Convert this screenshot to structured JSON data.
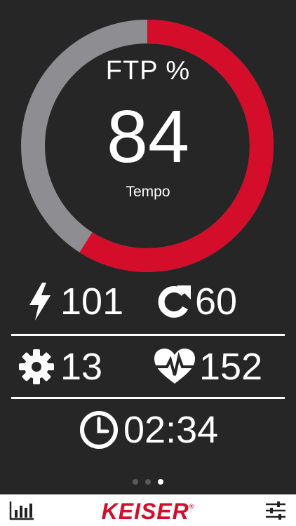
{
  "colors": {
    "background": "#262626",
    "ring_track": "#8e8e92",
    "ring_fill": "#d40d2b",
    "brand": "#d40d2b"
  },
  "gauge": {
    "label": "FTP %",
    "value": "84",
    "zone": "Tempo",
    "fill_fraction": 0.59
  },
  "metrics": {
    "power": {
      "icon": "lightning-bolt-icon",
      "value": "101"
    },
    "cadence": {
      "icon": "refresh-arrow-icon",
      "value": "60"
    },
    "gear": {
      "icon": "gear-icon",
      "value": "13"
    },
    "heart_rate": {
      "icon": "heart-pulse-icon",
      "value": "152"
    },
    "timer": {
      "icon": "clock-icon",
      "value": "02:34"
    }
  },
  "pager": {
    "count": 3,
    "active": 2
  },
  "bottom_bar": {
    "left_icon": "bar-chart-icon",
    "brand": "KEISER",
    "brand_mark": "®",
    "right_icon": "sliders-icon"
  }
}
